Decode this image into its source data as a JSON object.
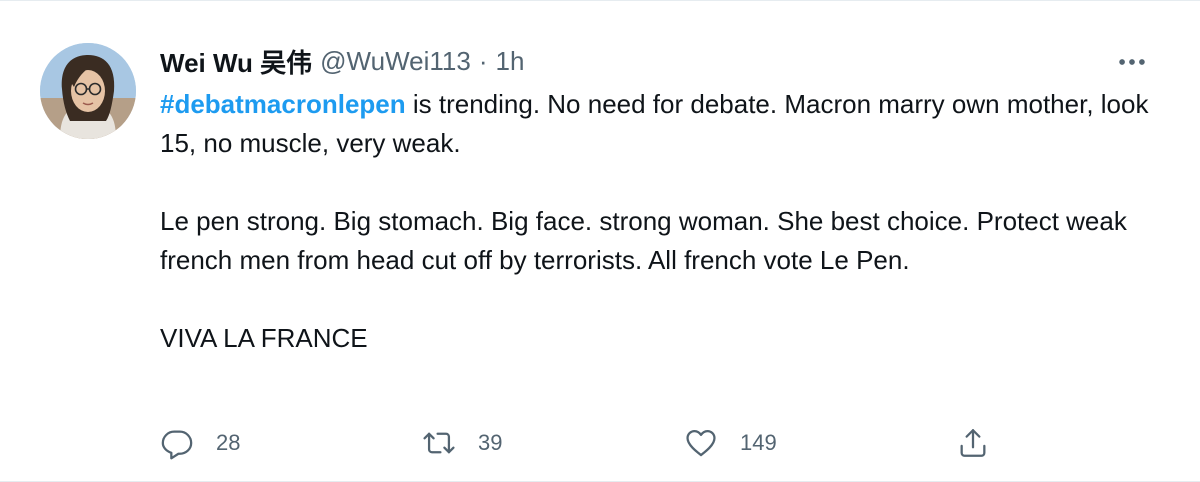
{
  "tweet": {
    "author_name": "Wei Wu 吴伟",
    "handle": "@WuWei113",
    "separator": "·",
    "time": "1h",
    "hashtag": "#debatmacronlepen",
    "text_line1_rest": " is trending. No need for debate. Macron marry own mother, look 15, no muscle, very weak.",
    "paragraph2": "Le pen strong. Big stomach. Big face. strong woman. She best choice. Protect weak french men from head cut off by terrorists. All french vote Le Pen.",
    "paragraph3": "VIVA LA FRANCE"
  },
  "actions": {
    "reply_count": "28",
    "retweet_count": "39",
    "like_count": "149"
  },
  "icons": {
    "more": "more-horizontal-icon",
    "reply": "reply-bubble-icon",
    "retweet": "retweet-icon",
    "like": "heart-icon",
    "share": "share-upload-icon"
  },
  "colors": {
    "hashtag": "#1d9bf0",
    "secondary_text": "#536471",
    "primary_text": "#0f1419"
  }
}
